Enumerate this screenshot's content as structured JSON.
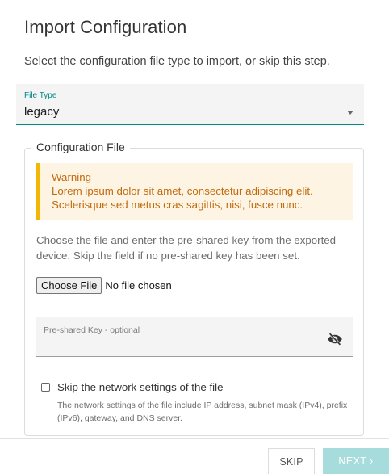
{
  "dialog": {
    "title": "Import Configuration",
    "subtitle": "Select the configuration file type to import, or skip this step."
  },
  "file_type": {
    "label": "File Type",
    "value": "legacy"
  },
  "config_file": {
    "legend": "Configuration File",
    "warning": {
      "title": "Warning",
      "line1": "Lorem ipsum dolor sit amet, consectetur adipiscing elit.",
      "line2": "Scelerisque sed metus cras sagittis, nisi, fusce nunc."
    },
    "description": "Choose the file and enter the pre-shared key from the exported device. Skip the field if no pre-shared key has been set.",
    "choose_file_label": "Choose File",
    "no_file_text": "No file chosen",
    "psk_label": "Pre-shared Key - optional",
    "skip_network_label": "Skip the network settings of the file",
    "skip_network_checked": false,
    "skip_network_desc": "The network settings of the file include IP address, subnet mask (IPv4), prefix (IPv6), gateway, and DNS server."
  },
  "footer": {
    "skip_label": "SKIP",
    "next_label": "NEXT ›"
  },
  "colors": {
    "accent": "#008787",
    "warning_bar": "#f2b705",
    "warning_bg": "#fdf4e3",
    "warning_text": "#c26a0c",
    "next_disabled": "#a6dcdc"
  },
  "icons": {
    "psk_visibility": "eye-off-icon",
    "select_caret": "caret-down-icon"
  }
}
